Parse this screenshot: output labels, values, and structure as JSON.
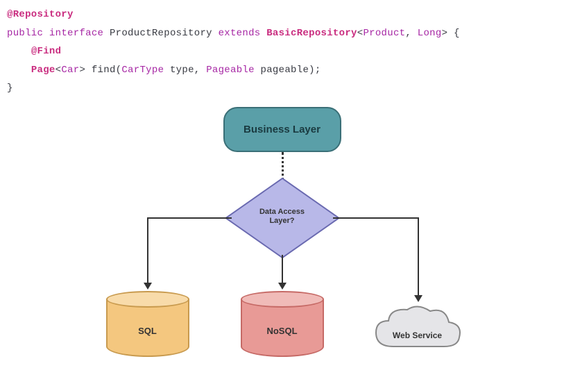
{
  "code": {
    "annotation_repository": "@Repository",
    "pub": "public",
    "iface": "interface",
    "class_name": "ProductRepository",
    "ext": "extends",
    "base_class": "BasicRepository",
    "generic_product": "Product",
    "generic_long": "Long",
    "brace_open": "{",
    "annotation_find": "@Find",
    "ret_type": "Page",
    "ret_generic": "Car",
    "method_name": "find",
    "param1_type": "CarType",
    "param1_name": "type",
    "param2_type": "Pageable",
    "param2_name": "pageable",
    "brace_close": "}"
  },
  "diagram": {
    "business_layer": "Business Layer",
    "decision_line1": "Data Access",
    "decision_line2": "Layer?",
    "sql": "SQL",
    "nosql": "NoSQL",
    "web_service": "Web Service"
  }
}
